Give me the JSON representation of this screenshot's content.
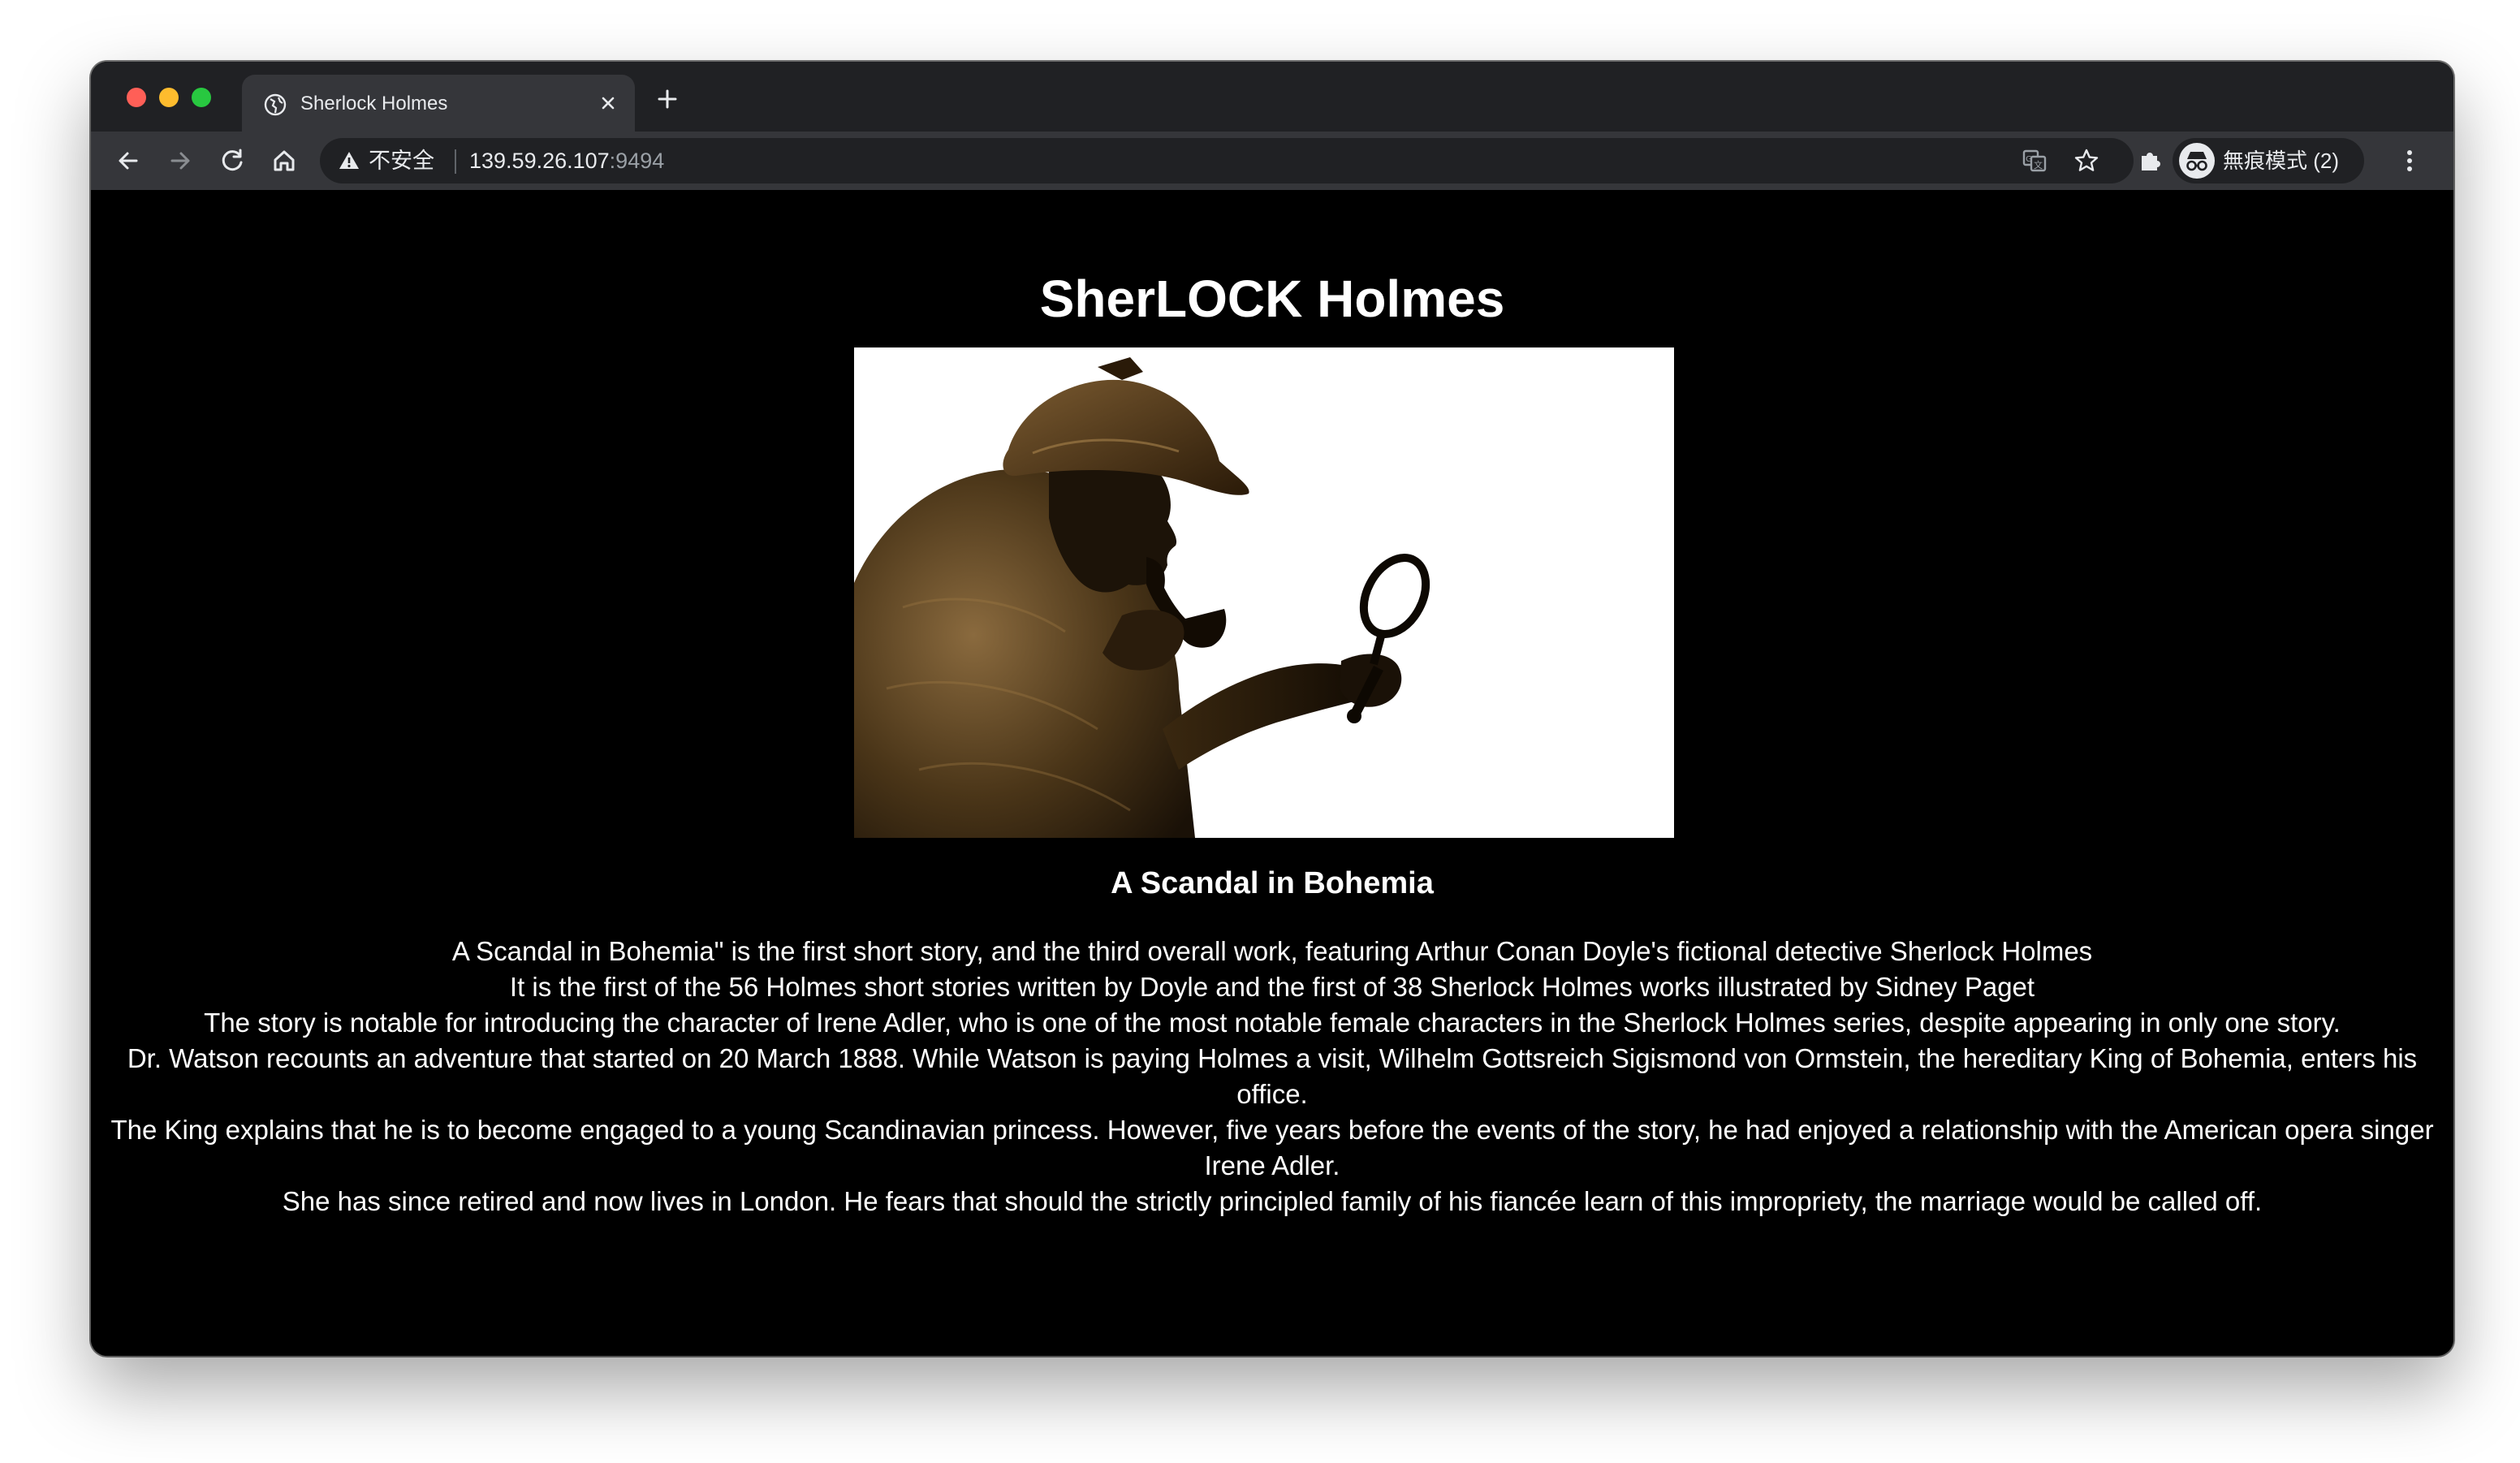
{
  "browser": {
    "tab": {
      "title": "Sherlock Holmes"
    },
    "omnibox": {
      "security_label": "不安全",
      "host": "139.59.26.107",
      "port": ":9494"
    },
    "profile": {
      "label": "無痕模式 (2)"
    }
  },
  "page": {
    "heading": "SherLOCK Holmes",
    "story_title": "A Scandal in Bohemia",
    "paragraphs": [
      "A Scandal in Bohemia\" is the first short story, and the third overall work, featuring Arthur Conan Doyle's fictional detective Sherlock Holmes",
      "It is the first of the 56 Holmes short stories written by Doyle and the first of 38 Sherlock Holmes works illustrated by Sidney Paget",
      "The story is notable for introducing the character of Irene Adler, who is one of the most notable female characters in the Sherlock Holmes series, despite appearing in only one story.",
      "Dr. Watson recounts an adventure that started on 20 March 1888. While Watson is paying Holmes a visit, Wilhelm Gottsreich Sigismond von Ormstein, the hereditary King of Bohemia, enters his office.",
      "The King explains that he is to become engaged to a young Scandinavian princess. However, five years before the events of the story, he had enjoyed a relationship with the American opera singer Irene Adler.",
      "She has since retired and now lives in London. He fears that should the strictly principled family of his fiancée learn of this impropriety, the marriage would be called off."
    ]
  },
  "icons": {
    "tab_favicon": "globe-icon",
    "tab_close": "close-icon",
    "new_tab": "plus-icon",
    "back": "back-arrow-icon",
    "forward": "forward-arrow-icon",
    "reload": "reload-icon",
    "home": "home-icon",
    "security": "warning-icon",
    "translate": "translate-icon",
    "bookmark": "star-icon",
    "extensions": "puzzle-icon",
    "profile": "incognito-icon",
    "menu": "kebab-menu-icon"
  },
  "colors": {
    "page_background": "#000000",
    "page_text": "#ffffff",
    "tabstrip": "#202124",
    "toolbar": "#35363a"
  }
}
